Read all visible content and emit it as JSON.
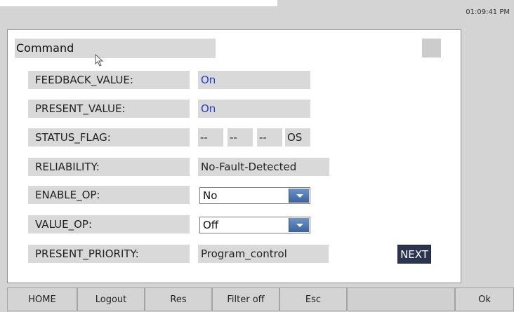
{
  "clock": "01:09:41 PM",
  "dialog": {
    "title": "Command",
    "rows": {
      "feedback": {
        "label": "FEEDBACK_VALUE:",
        "value": "On"
      },
      "present": {
        "label": "PRESENT_VALUE:",
        "value": "On"
      },
      "status": {
        "label": "STATUS_FLAG:",
        "flags": [
          "--",
          "--",
          "--",
          "OS"
        ]
      },
      "reliability": {
        "label": "RELIABILITY:",
        "value": "No-Fault-Detected"
      },
      "enable_op": {
        "label": "ENABLE_OP:",
        "value": "No"
      },
      "value_op": {
        "label": "VALUE_OP:",
        "value": "Off"
      },
      "priority": {
        "label": "PRESENT_PRIORITY:",
        "value": "Program_control"
      }
    },
    "next_label": "NEXT"
  },
  "toolbar": {
    "home": "HOME",
    "logout": "Logout",
    "res": "Res",
    "filter": "Filter off",
    "esc": "Esc",
    "ok": "Ok"
  },
  "colors": {
    "value_blue": "#1f3fd1",
    "next_bg": "#2a3450",
    "dropdown_blue": "#3a62a3"
  }
}
